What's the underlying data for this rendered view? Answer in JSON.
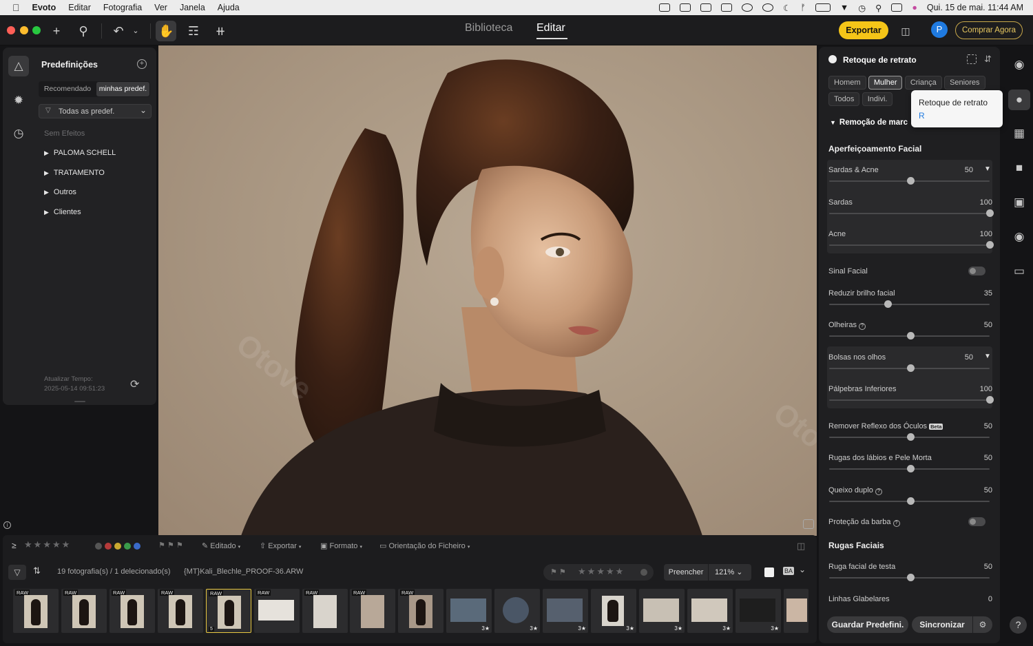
{
  "menubar": {
    "app": "Evoto",
    "items": [
      "Editar",
      "Fotografia",
      "Ver",
      "Janela",
      "Ajuda"
    ],
    "datetime": "Qui. 15 de mai.  11:44 AM"
  },
  "toolbar": {
    "tabs": [
      "Biblioteca",
      "Editar"
    ],
    "export_label": "Exportar",
    "avatar_initial": "P",
    "buy_label": "Comprar Agora"
  },
  "left_panel": {
    "title": "Predefinições",
    "tabs": [
      "Recomendado",
      "minhas predef."
    ],
    "filter_label": "Todas as predef.",
    "no_effects": "Sem Efeitos",
    "folders": [
      "PALOMA SCHELL",
      "TRATAMENTO",
      "Outros",
      "Clientes"
    ],
    "update_label": "Atualizar Tempo:",
    "update_time": "2025-05-14 09:51:23"
  },
  "photo": {
    "watermark": "Otove"
  },
  "right_panel": {
    "title": "Retoque de retrato",
    "chips_row1": [
      "Homem",
      "Mulher",
      "Criança",
      "Seniores"
    ],
    "chips_row2": [
      "Todos",
      "Indivi."
    ],
    "tooltip_title": "Retoque de retrato",
    "tooltip_key": "R",
    "collapsed_section": "Remoção de marc",
    "section_facial": "Aperfeiçoamento Facial",
    "sliders": {
      "sardas_acne": {
        "label": "Sardas & Acne",
        "value": "50"
      },
      "sardas": {
        "label": "Sardas",
        "value": "100"
      },
      "acne": {
        "label": "Acne",
        "value": "100"
      },
      "sinal_facial": {
        "label": "Sinal Facial"
      },
      "reduzir_brilho": {
        "label": "Reduzir brilho facial",
        "value": "35"
      },
      "olheiras": {
        "label": "Olheiras",
        "value": "50"
      },
      "bolsas": {
        "label": "Bolsas nos olhos",
        "value": "50"
      },
      "palpebras": {
        "label": "Pálpebras Inferiores",
        "value": "100"
      },
      "reflexo": {
        "label": "Remover Reflexo dos Óculos",
        "badge": "Beta",
        "value": "50"
      },
      "rugas_labios": {
        "label": "Rugas dos lábios e Pele Morta",
        "value": "50"
      },
      "queixo": {
        "label": "Queixo duplo",
        "value": "50"
      },
      "barba": {
        "label": "Proteção da barba"
      },
      "ruga_testa": {
        "label": "Ruga facial de testa",
        "value": "50"
      },
      "glabelares": {
        "label": "Linhas Glabelares",
        "value": "0"
      }
    },
    "section_rugas": "Rugas Faciais",
    "save_preset_label": "Guardar Predefini.",
    "sync_label": "Sincronizar"
  },
  "bottom": {
    "editado": "Editado",
    "exportar": "Exportar",
    "formato": "Formato",
    "orientacao": "Orientação do Ficheiro",
    "photo_count": "19 fotografia(s) / 1 delecionado(s)",
    "filename": "{MT}Kali_Blechle_PROOF-36.ARW",
    "fill_label": "Preencher",
    "zoom": "121%",
    "ba_label": "BA",
    "raw_tag": "RAW",
    "rating": "3★",
    "selected_index": "5"
  }
}
